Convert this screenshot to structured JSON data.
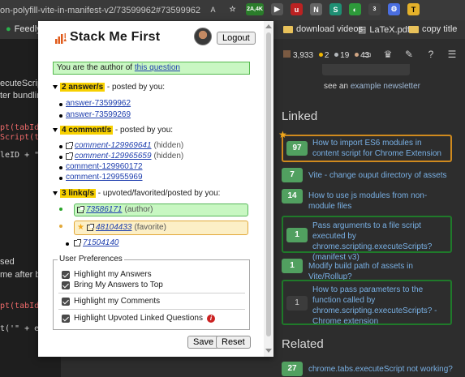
{
  "browser": {
    "url_fragment": "on-polyfill-vite-in-manifest-v2/73599962#73599962",
    "extension_badge": "2A,4K",
    "extension_badge2": "3",
    "bookmarks": [
      {
        "label": "Feedly"
      },
      {
        "label": "download videos"
      },
      {
        "label": "LaTeX.pdf"
      },
      {
        "label": "copy title"
      }
    ]
  },
  "code_page": {
    "lines": [
      "ecuteScript,",
      "ter bundling",
      "pt(tabId,",
      "Script(tab",
      "leID + \"'",
      "sed",
      "me after b",
      "pt(tabId,",
      "t('\" + el"
    ]
  },
  "popup": {
    "title": "Stack Me First",
    "logout_label": "Logout",
    "author_prefix": "You are the author of ",
    "author_link": "this question",
    "answers": {
      "count_label": "2 answer/s",
      "suffix": " - posted by you:",
      "items": [
        "answer-73599962",
        "answer-73599269"
      ]
    },
    "comments": {
      "count_label": "4 comment/s",
      "suffix": " - posted by you:",
      "items": [
        {
          "link": "comment-129969641",
          "note": "(hidden)"
        },
        {
          "link": "comment-129965659",
          "note": "(hidden)"
        },
        {
          "link": "comment-129960172",
          "note": ""
        },
        {
          "link": "comment-129955969",
          "note": ""
        }
      ]
    },
    "linkqs": {
      "count_label": "3 linkq/s",
      "suffix": " - upvoted/favorited/posted by you:",
      "items": [
        {
          "link": "73586171",
          "note": "(author)"
        },
        {
          "link": "48104433",
          "note": "(favorite)"
        },
        {
          "link": "71504140",
          "note": ""
        }
      ]
    },
    "preferences": {
      "legend": "User Preferences",
      "items": [
        "Highlight my Answers",
        "Bring My Answers to Top",
        "Highlight my Comments",
        "Highlight Upvoted Linked Questions"
      ]
    },
    "save_label": "Save",
    "reset_label": "Reset"
  },
  "so_page": {
    "reputation": "3,933",
    "gold": "2",
    "silver": "19",
    "bronze": "43",
    "see_prefix": "see an ",
    "see_link": "example newsletter",
    "linked_title": "Linked",
    "related_title": "Related",
    "linked": [
      {
        "score": "97",
        "title": "How to import ES6 modules in content script for Chrome Extension"
      },
      {
        "score": "7",
        "title": "Vite - change ouput directory of assets"
      },
      {
        "score": "14",
        "title": "How to use js modules from non-module files"
      },
      {
        "score": "1",
        "title": "Pass arguments to a file script executed by chrome.scripting.executeScripts? (manifest v3)"
      },
      {
        "score": "1",
        "title": "Modify build path of assets in Vite/Rollup?"
      },
      {
        "score": "1",
        "title": "How to pass parameters to the function called by chrome.scripting.executeScripts? - Chrome extension"
      }
    ],
    "related": [
      {
        "score": "27",
        "title": "chrome.tabs.executeScript not working?"
      }
    ]
  },
  "colors": {
    "highlight_yellow": "#f7d000",
    "author_green": "#c9f7c3",
    "so_score_green": "#51a060",
    "so_link_blue": "#79b0e4"
  }
}
